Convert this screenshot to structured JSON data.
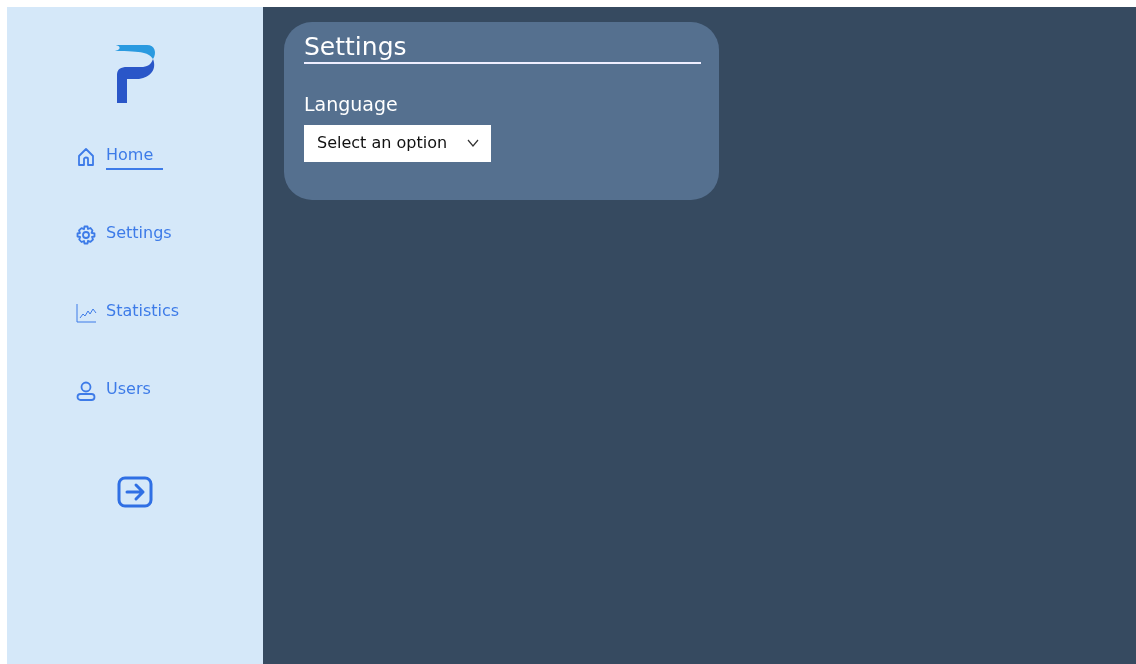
{
  "sidebar": {
    "items": [
      {
        "kind": "home",
        "label": "Home",
        "selected": true
      },
      {
        "kind": "settings",
        "label": "Settings",
        "selected": false
      },
      {
        "kind": "statistics",
        "label": "Statistics",
        "selected": false
      },
      {
        "kind": "users",
        "label": "Users",
        "selected": false
      }
    ]
  },
  "settings_panel": {
    "title": "Settings",
    "language": {
      "label": "Language",
      "placeholder": "Select an option"
    }
  }
}
